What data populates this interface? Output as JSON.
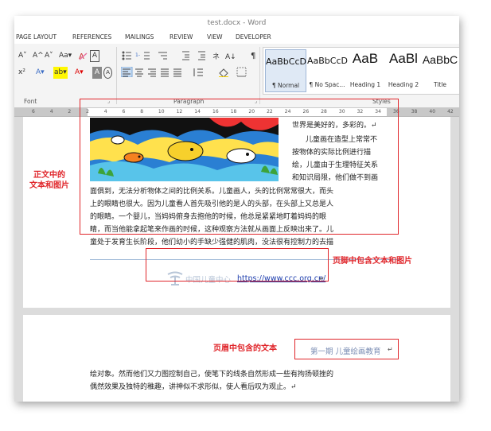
{
  "window": {
    "title": "test.docx - Word"
  },
  "tabs": [
    "PAGE LAYOUT",
    "REFERENCES",
    "MAILINGS",
    "REVIEW",
    "VIEW",
    "DEVELOPER"
  ],
  "ribbon": {
    "font_group": {
      "label": "Font",
      "row1": [
        "A˅",
        "A^",
        "A˅",
        "Aa▾",
        "A",
        "A"
      ],
      "row2": [
        "x²",
        "A▾",
        "ab▾",
        "A▾",
        "A",
        "A"
      ]
    },
    "paragraph_group": {
      "label": "Paragraph"
    },
    "styles_group": {
      "label": "Styles",
      "items": [
        {
          "preview": "AaBbCcD",
          "name": "¶ Normal"
        },
        {
          "preview": "AaBbCcD",
          "name": "¶ No Spac..."
        },
        {
          "preview": "AaB",
          "name": "Heading 1"
        },
        {
          "preview": "AaBl",
          "name": "Heading 2"
        },
        {
          "preview": "AaBbC",
          "name": "Title"
        }
      ]
    }
  },
  "ruler": {
    "ticks": [
      "6",
      "4",
      "2",
      "2",
      "4",
      "6",
      "8",
      "10",
      "12",
      "14",
      "16",
      "18",
      "20",
      "22",
      "24",
      "26",
      "28",
      "30",
      "32",
      "34",
      "36",
      "38",
      "40",
      "42"
    ]
  },
  "page1": {
    "right_lines": [
      "世界是美好的，多彩的。↵",
      "儿童画在造型上常常不",
      "按物体的实际比例进行描",
      "绘，儿童由于生理特征关系",
      "和知识局限，他们做不到画"
    ],
    "full_lines": [
      "面俱到，无法分析物体之间的比例关系。儿童画人，头的比例常常很大，而头",
      "上的眼睛也很大。因为儿童看人首先吸引他的是人的头部，在头部上又总是人",
      "的眼睛。一个婴儿，当妈妈俯身去抱他的时候，他总是紧紧地盯着妈妈的眼",
      "睛，而当他能拿起笔来作画的时候，这种观察方法就从画面上反映出来了。儿",
      "童处于发育生长阶段，他们幼小的手缺少强健的肌肉，没法很有控制力的去描"
    ],
    "footer": {
      "logo_text": "中国儿童中心",
      "url": "https://www.ccc.org.cn/",
      "mark": "↵"
    }
  },
  "page2": {
    "header_text": "第一期  儿童绘画教育",
    "header_mark": "↵",
    "lines": [
      "绘对象。然而他们又力图控制自己，使笔下的线条自然形成一些有拘扬顿挫的",
      "偶然效果及独特的稚趣，讲神似不求形似，使人看后叹为观止。↵"
    ]
  },
  "annotations": {
    "body": [
      "正文中的",
      "文本和图片"
    ],
    "footer": "页脚中包含文本和图片",
    "header": "页眉中包含的文本"
  },
  "colors": {
    "annotation_red": "#e0262b",
    "url_blue": "#1f3fae",
    "header_gray_blue": "#7d8fb5"
  }
}
